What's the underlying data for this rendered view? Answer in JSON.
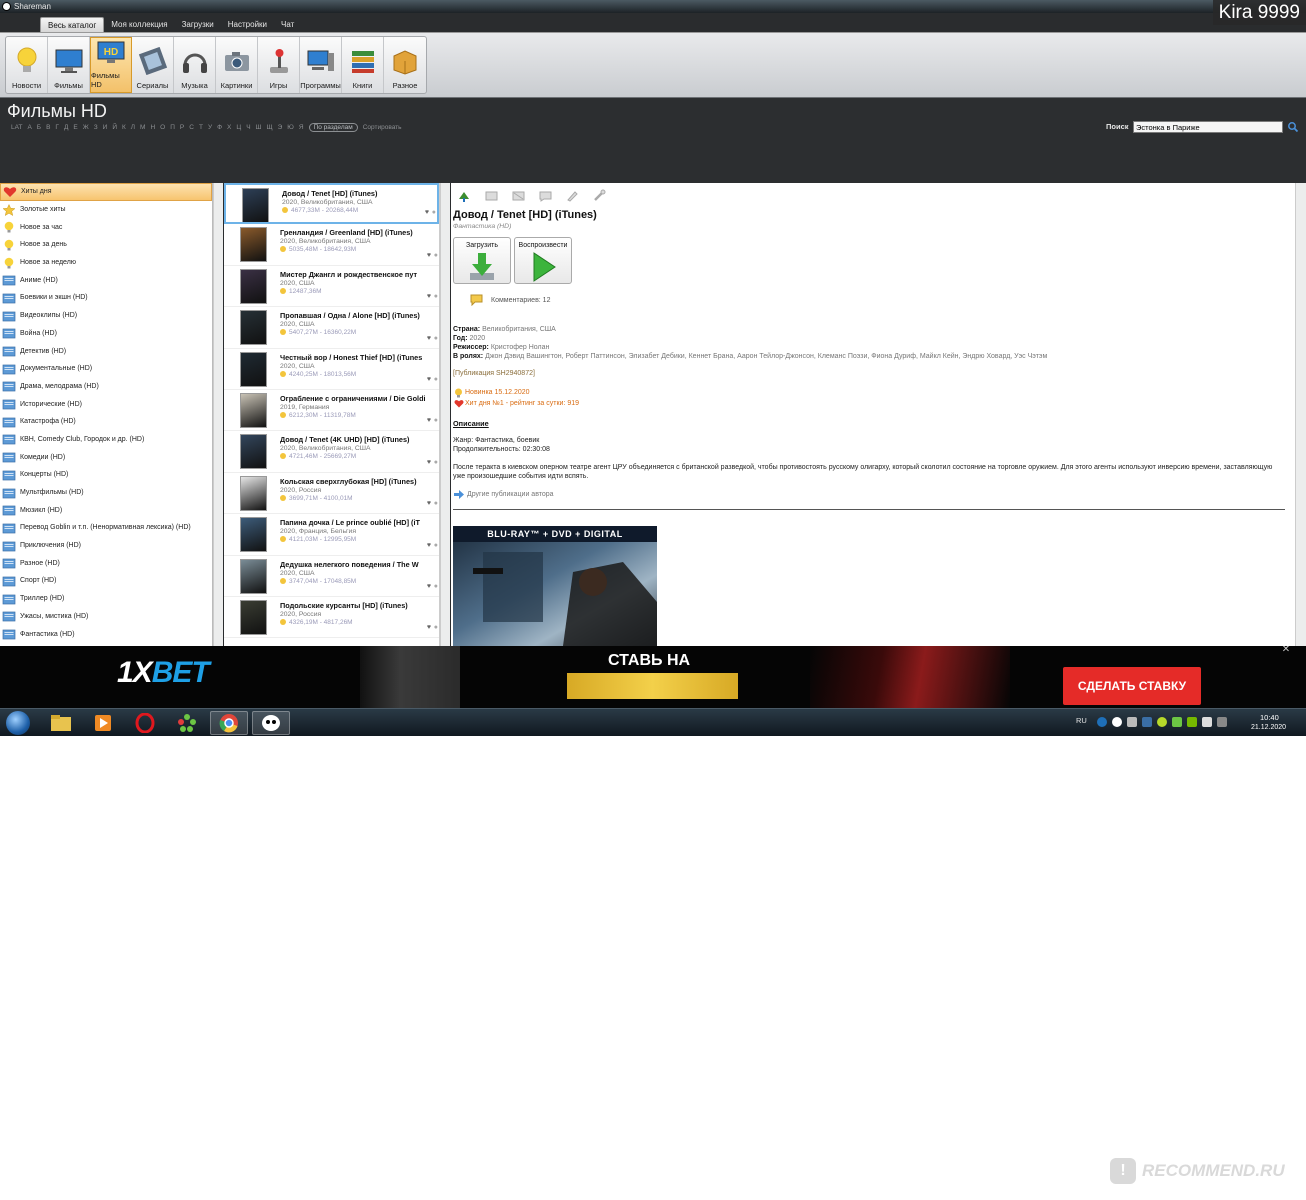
{
  "window": {
    "title": "Shareman"
  },
  "watermark_top": "Kira 9999",
  "menu_tabs": [
    "Весь каталог",
    "Моя коллекция",
    "Загрузки",
    "Настройки",
    "Чат"
  ],
  "toolbar": [
    {
      "label": "Новости",
      "icon": "bulb-icon"
    },
    {
      "label": "Фильмы",
      "icon": "monitor-icon"
    },
    {
      "label": "Фильмы HD",
      "icon": "hd-monitor-icon"
    },
    {
      "label": "Сериалы",
      "icon": "film-strip-icon"
    },
    {
      "label": "Музыка",
      "icon": "headphones-icon"
    },
    {
      "label": "Картинки",
      "icon": "camera-icon"
    },
    {
      "label": "Игры",
      "icon": "joystick-icon"
    },
    {
      "label": "Программы",
      "icon": "computer-icon"
    },
    {
      "label": "Книги",
      "icon": "books-icon"
    },
    {
      "label": "Разное",
      "icon": "box-icon"
    }
  ],
  "header": {
    "title": "Фильмы HD",
    "alphabet": [
      "LAT",
      "А",
      "Б",
      "В",
      "Г",
      "Д",
      "Е",
      "Ж",
      "З",
      "И",
      "Й",
      "К",
      "Л",
      "М",
      "Н",
      "О",
      "П",
      "Р",
      "С",
      "Т",
      "У",
      "Ф",
      "Х",
      "Ц",
      "Ч",
      "Ш",
      "Щ",
      "Э",
      "Ю",
      "Я"
    ],
    "by_sections": "По разделам",
    "sort": "Сортировать",
    "search_label": "Поиск",
    "search_value": "Эстонка в Париже"
  },
  "categories": [
    {
      "label": "Хиты дня",
      "icon": "heart-icon"
    },
    {
      "label": "Золотые хиты",
      "icon": "star-icon"
    },
    {
      "label": "Новое за час",
      "icon": "bulb-icon"
    },
    {
      "label": "Новое за день",
      "icon": "bulb-icon"
    },
    {
      "label": "Новое за неделю",
      "icon": "bulb-icon"
    },
    {
      "label": "Аниме (HD)",
      "icon": "folder-icon"
    },
    {
      "label": "Боевики и экшн (HD)",
      "icon": "folder-icon"
    },
    {
      "label": "Видеоклипы (HD)",
      "icon": "folder-icon"
    },
    {
      "label": "Война (HD)",
      "icon": "folder-icon"
    },
    {
      "label": "Детектив (HD)",
      "icon": "folder-icon"
    },
    {
      "label": "Документальные (HD)",
      "icon": "folder-icon"
    },
    {
      "label": "Драма, мелодрама (HD)",
      "icon": "folder-icon"
    },
    {
      "label": "Исторические (HD)",
      "icon": "folder-icon"
    },
    {
      "label": "Катастрофа (HD)",
      "icon": "folder-icon"
    },
    {
      "label": "КВН, Comedy Club, Городок и др. (HD)",
      "icon": "folder-icon"
    },
    {
      "label": "Комедии (HD)",
      "icon": "folder-icon"
    },
    {
      "label": "Концерты (HD)",
      "icon": "folder-icon"
    },
    {
      "label": "Мультфильмы (HD)",
      "icon": "folder-icon"
    },
    {
      "label": "Мюзикл (HD)",
      "icon": "folder-icon"
    },
    {
      "label": "Перевод Goblin и т.п. (Ненормативная лексика) (HD)",
      "icon": "folder-icon"
    },
    {
      "label": "Приключения (HD)",
      "icon": "folder-icon"
    },
    {
      "label": "Разное (HD)",
      "icon": "folder-icon"
    },
    {
      "label": "Спорт (HD)",
      "icon": "folder-icon"
    },
    {
      "label": "Триллер (HD)",
      "icon": "folder-icon"
    },
    {
      "label": "Ужасы, мистика (HD)",
      "icon": "folder-icon"
    },
    {
      "label": "Фантастика (HD)",
      "icon": "folder-icon"
    }
  ],
  "movies": [
    {
      "title": "Довод / Tenet [HD] (iTunes)",
      "meta": "2020, Великобритания, США",
      "size": "4677,33М - 20268,44М",
      "thumb": "#2d3f56"
    },
    {
      "title": "Гренландия / Greenland [HD] (iTunes)",
      "meta": "2020, Великобритания, США",
      "size": "5035,48М - 18642,93М",
      "thumb": "#8a5a2b"
    },
    {
      "title": "Мистер Джангл и рождественское пут",
      "meta": "2020, США",
      "size": "12487,36М",
      "thumb": "#3a3044"
    },
    {
      "title": "Пропавшая / Одна / Alone [HD] (iTunes)",
      "meta": "2020, США",
      "size": "5407,27М - 16360,22М",
      "thumb": "#263036"
    },
    {
      "title": "Честный вор / Honest Thief [HD] (iTunes",
      "meta": "2020, США",
      "size": "4240,25М - 18013,56М",
      "thumb": "#1f2a33"
    },
    {
      "title": "Ограбление с ограничениями / Die Goldi",
      "meta": "2019, Германия",
      "size": "6212,30М - 11319,78М",
      "thumb": "#c8c2b5"
    },
    {
      "title": "Довод / Tenet (4K UHD) [HD] (iTunes)",
      "meta": "2020, Великобритания, США",
      "size": "4721,46М - 25669,27М",
      "thumb": "#33465c"
    },
    {
      "title": "Кольская сверхглубокая [HD] (iTunes)",
      "meta": "2020, Россия",
      "size": "3699,71М - 4100,01М",
      "thumb": "#e6e6e6"
    },
    {
      "title": "Папина дочка / Le prince oublié [HD] (iT",
      "meta": "2020, Франция, Бельгия",
      "size": "4121,03М - 12995,95М",
      "thumb": "#3d5c7a"
    },
    {
      "title": "Дедушка нелегкого поведения / The W",
      "meta": "2020, США",
      "size": "3747,04М - 17048,85М",
      "thumb": "#7a8c96"
    },
    {
      "title": "Подольские курсанты [HD] (iTunes)",
      "meta": "2020, Россия",
      "size": "4326,19М - 4817,26М",
      "thumb": "#3a3d33"
    }
  ],
  "detail": {
    "title": "Довод / Tenet [HD] (iTunes)",
    "genre_tag": "Фантастика (HD)",
    "download_label": "Загрузить",
    "play_label": "Воспроизвести",
    "comments": "Комментариев: 12",
    "country_label": "Страна:",
    "country": "Великобритания, США",
    "year_label": "Год:",
    "year": "2020",
    "director_label": "Режиссер:",
    "director": "Кристофер Нолан",
    "cast_label": "В ролях:",
    "cast": "Джон Дэвид Вашингтон, Роберт Паттинсон, Элизабет Дебики, Кеннет Брана, Аарон Тейлор-Джонсон, Клеманс Поэзи, Фиона Дуриф, Майкл Кейн, Эндрю Ховард, Уэс Чэтэм",
    "publication": "[Публикация SH2940872]",
    "new_badge": "Новинка 15.12.2020",
    "hit_badge": "Хит дня №1 - рейтинг за сутки: 919",
    "description_head": "Описание",
    "genre_line": "Жанр: Фантастика, боевик",
    "duration_line": "Продолжительность: 02:30:08",
    "plot": "После теракта в киевском оперном театре агент ЦРУ объединяется с британской разведкой, чтобы противостоять русскому олигарху, который сколотил состояние на торговле оружием. Для этого агенты используют инверсию времени, заставляющую уже произошедшие события идти вспять.",
    "other_pubs": "Другие публикации автора",
    "poster_band": "BLU-RAY™ + DVD + DIGITAL"
  },
  "ad": {
    "logo_prefix": "1X",
    "logo_suffix": "BET",
    "headline": "СТАВЬ НА",
    "cta": "СДЕЛАТЬ СТАВКУ"
  },
  "taskbar": {
    "lang": "RU",
    "time": "10:40",
    "date": "21.12.2020"
  },
  "watermark_bottom": "RECOMMEND.RU",
  "colors": {
    "accent_orange": "#f7c46f",
    "selection_blue": "#6db3e8",
    "ad_red": "#e52b28",
    "ad_blue": "#1ea0e6"
  }
}
